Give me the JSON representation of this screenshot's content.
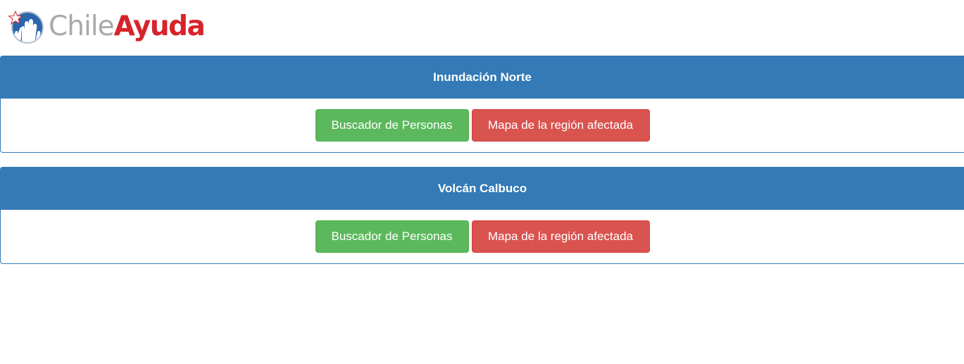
{
  "brand": {
    "name_part1": "Chile",
    "name_part2": "Ayuda",
    "logo_icon": "hands-star-globe-icon",
    "color_gray": "#a9a9ac",
    "color_red": "#d7232a",
    "color_blue": "#2a66ad"
  },
  "theme": {
    "primary": "#337ab7",
    "success": "#5cb85c",
    "danger": "#d9534f"
  },
  "events": [
    {
      "title": "Inundación Norte",
      "search_button": "Buscador de Personas",
      "map_button": "Mapa de la región afectada"
    },
    {
      "title": "Volcán Calbuco",
      "search_button": "Buscador de Personas",
      "map_button": "Mapa de la región afectada"
    }
  ]
}
